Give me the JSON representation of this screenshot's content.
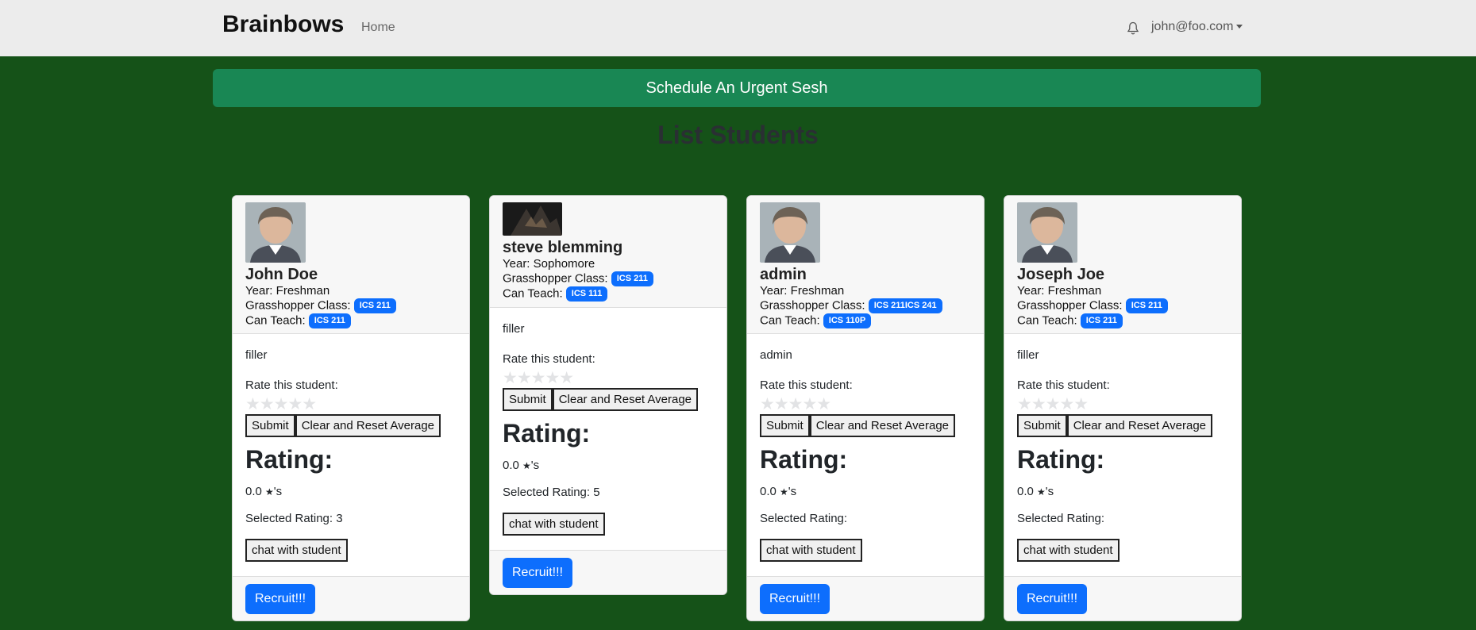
{
  "navbar": {
    "brand": "Brainbows",
    "home": "Home",
    "user": "john@foo.com"
  },
  "urgent_button": "Schedule An Urgent Sesh",
  "page_title": "List Students",
  "labels": {
    "year": "Year: ",
    "class": "Grasshopper Class: ",
    "teach": "Can Teach: ",
    "rate": "Rate this student:",
    "submit": "Submit",
    "clear": "Clear and Reset Average",
    "rating": "Rating:",
    "stars_suffix": "'s",
    "selected": "Selected Rating: ",
    "chat": "chat with student",
    "recruit": "Recruit!!!"
  },
  "students": [
    {
      "name": "John Doe",
      "year": "Freshman",
      "class": "ICS 211",
      "teach": "ICS 211",
      "desc": "filler",
      "rating": "0.0",
      "selected": "3"
    },
    {
      "name": "steve blemming",
      "year": "Sophomore",
      "class": "ICS 211",
      "teach": "ICS 111",
      "desc": "filler",
      "rating": "0.0",
      "selected": "5"
    },
    {
      "name": "admin",
      "year": "Freshman",
      "class": "ICS 211ICS 241",
      "teach": "ICS 110P",
      "desc": "admin",
      "rating": "0.0",
      "selected": ""
    },
    {
      "name": "Joseph Joe",
      "year": "Freshman",
      "class": "ICS 211",
      "teach": "ICS 211",
      "desc": "filler",
      "rating": "0.0",
      "selected": ""
    }
  ],
  "colors": {
    "background": "#155218",
    "urgent": "#198754",
    "primary": "#0d6efd"
  }
}
